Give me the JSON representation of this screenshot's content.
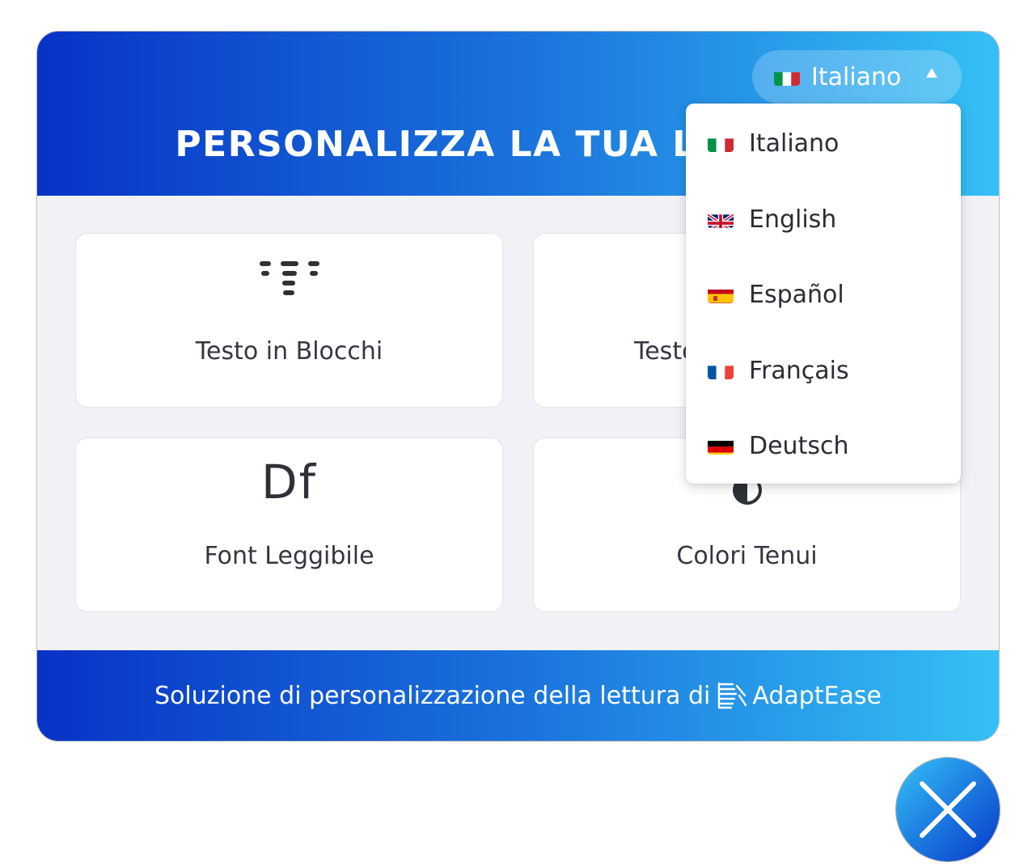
{
  "header": {
    "title": "PERSONALIZZA LA TUA LETTURA",
    "language_selected": "Italiano",
    "language_flag": "italy-flag-icon"
  },
  "language_menu": {
    "open": true,
    "items": [
      {
        "label": "Italiano",
        "flag": "italy-flag-icon"
      },
      {
        "label": "English",
        "flag": "uk-flag-icon"
      },
      {
        "label": "Español",
        "flag": "spain-flag-icon"
      },
      {
        "label": "Français",
        "flag": "france-flag-icon"
      },
      {
        "label": "Deutsch",
        "flag": "germany-flag-icon"
      }
    ]
  },
  "features": [
    {
      "label": "Testo in Blocchi",
      "icon": "text-blocks-icon"
    },
    {
      "label": "Testo",
      "icon": "text-icon"
    },
    {
      "label": "Font Leggibile",
      "icon": "readable-font-icon",
      "icon_text": "Df"
    },
    {
      "label": "Colori Tenui",
      "icon": "contrast-icon"
    }
  ],
  "footer": {
    "text": "Soluzione di personalizzazione della lettura di",
    "brand": "AdaptEase",
    "brand_icon": "adaptease-logo-icon"
  },
  "close_button": {
    "icon": "close-icon"
  },
  "colors": {
    "gradient_start": "#0733c6",
    "gradient_end": "#35c0f5",
    "card_background": "#ffffff",
    "panel_background": "#f1f2f5",
    "text_dark": "#333740"
  }
}
